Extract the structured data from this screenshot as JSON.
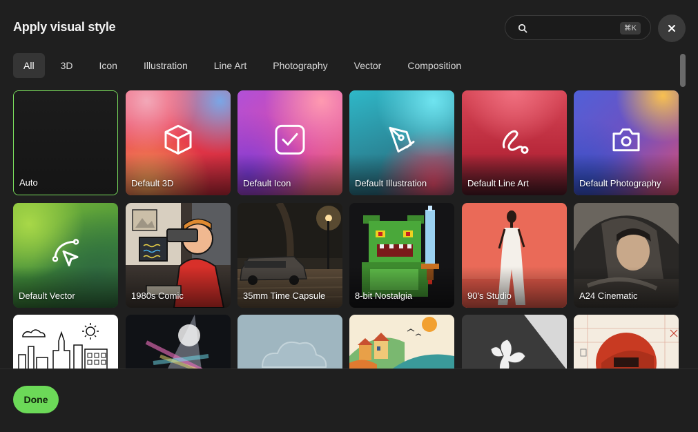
{
  "header": {
    "title": "Apply visual style"
  },
  "search": {
    "value": "",
    "shortcut": "⌘K"
  },
  "tabs": [
    {
      "label": "All",
      "active": true
    },
    {
      "label": "3D",
      "active": false
    },
    {
      "label": "Icon",
      "active": false
    },
    {
      "label": "Illustration",
      "active": false
    },
    {
      "label": "Line Art",
      "active": false
    },
    {
      "label": "Photography",
      "active": false
    },
    {
      "label": "Vector",
      "active": false
    },
    {
      "label": "Composition",
      "active": false
    }
  ],
  "styles": [
    {
      "label": "Auto",
      "selected": true
    },
    {
      "label": "Default 3D",
      "icon": "cube-icon"
    },
    {
      "label": "Default Icon",
      "icon": "checkbox-icon"
    },
    {
      "label": "Default Illustration",
      "icon": "pen-nib-icon"
    },
    {
      "label": "Default Line Art",
      "icon": "squiggle-path-icon"
    },
    {
      "label": "Default Photography",
      "icon": "camera-icon"
    },
    {
      "label": "Default Vector",
      "icon": "vector-cursor-icon"
    },
    {
      "label": "1980s Comic"
    },
    {
      "label": "35mm Time Capsule"
    },
    {
      "label": "8-bit Nostalgia"
    },
    {
      "label": "90's Studio"
    },
    {
      "label": "A24 Cinematic"
    },
    {
      "label": ""
    },
    {
      "label": ""
    },
    {
      "label": ""
    },
    {
      "label": ""
    },
    {
      "label": ""
    },
    {
      "label": ""
    }
  ],
  "footer": {
    "done_label": "Done"
  },
  "colors": {
    "accent": "#6cd958",
    "selected_border": "#7ce25e",
    "background": "#1f1f1f"
  }
}
